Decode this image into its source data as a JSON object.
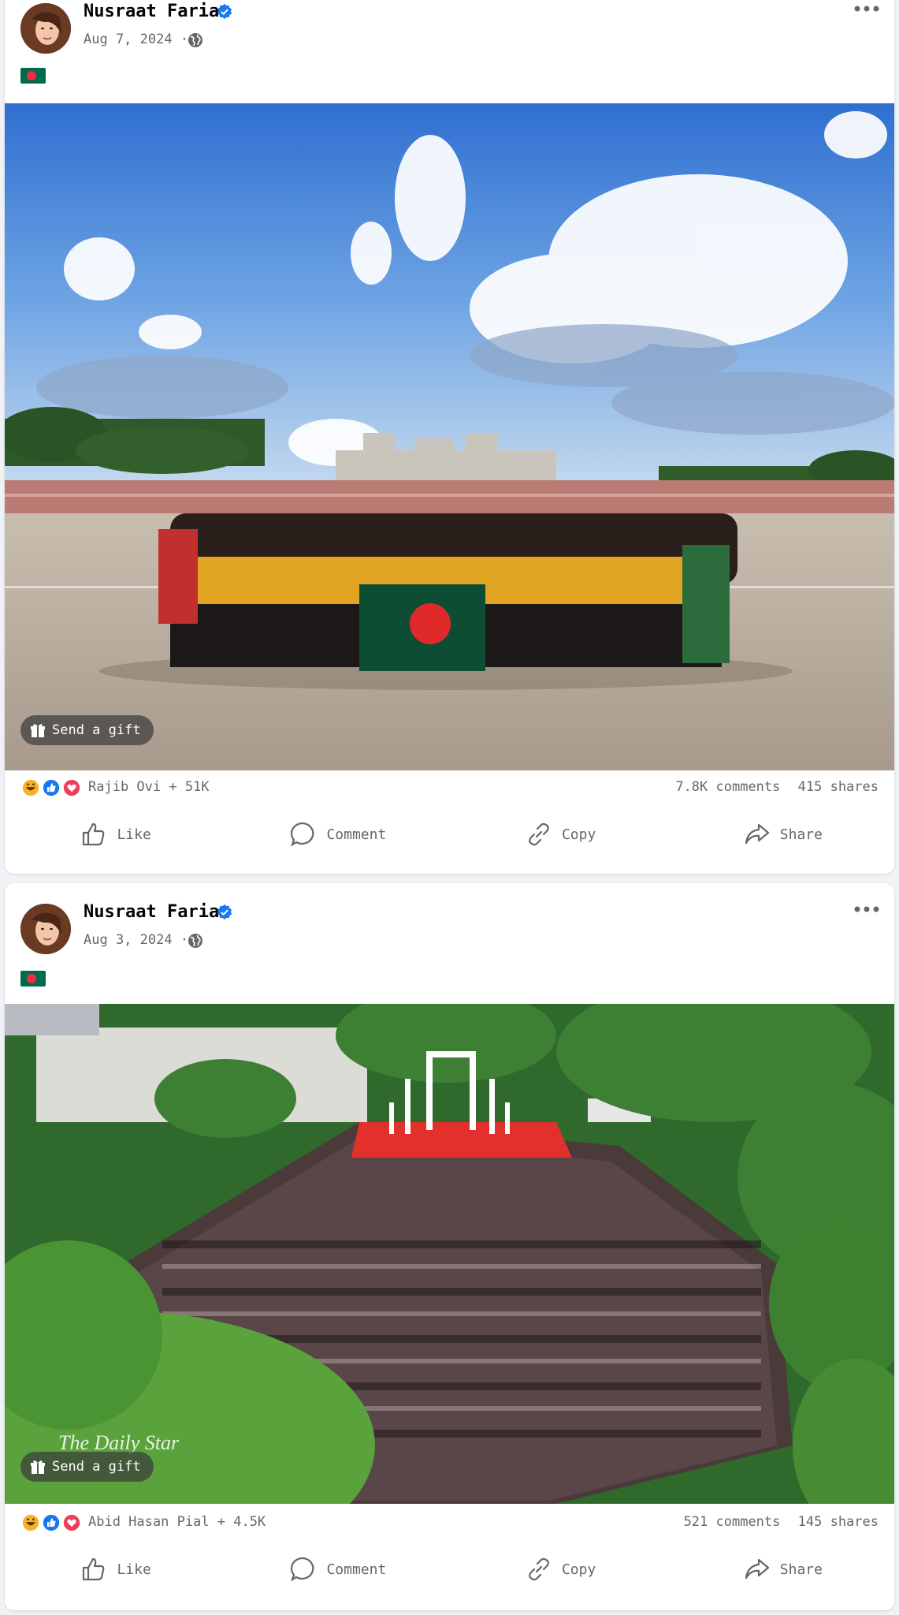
{
  "posts": [
    {
      "author": "Nusraat Faria",
      "date": "Aug 7, 2024",
      "date_separator": "·",
      "caption_icon": "bangladesh-flag-icon",
      "gift_label": "Send a gift",
      "reactors_text": "Rajib Ovi + 51K",
      "comments": "7.8K comments",
      "shares": "415 shares",
      "photo_description_icon": "national-assembly-group-photo"
    },
    {
      "author": "Nusraat Faria",
      "date": "Aug 3, 2024",
      "date_separator": "·",
      "caption_icon": "bangladesh-flag-icon",
      "gift_label": "Send a gift",
      "reactors_text": "Abid Hasan Pial + 4.5K",
      "comments": "521 comments",
      "shares": "145 shares",
      "watermark": "The Daily Star"
    }
  ],
  "actions": {
    "like": "Like",
    "comment": "Comment",
    "copy": "Copy",
    "share": "Share"
  },
  "colors": {
    "verified": "#1877f2",
    "like_reaction": "#1877f2",
    "love_reaction": "#f33e58",
    "haha_reaction": "#f7b125",
    "flag_green": "#006a4e",
    "flag_red": "#f42a41"
  }
}
